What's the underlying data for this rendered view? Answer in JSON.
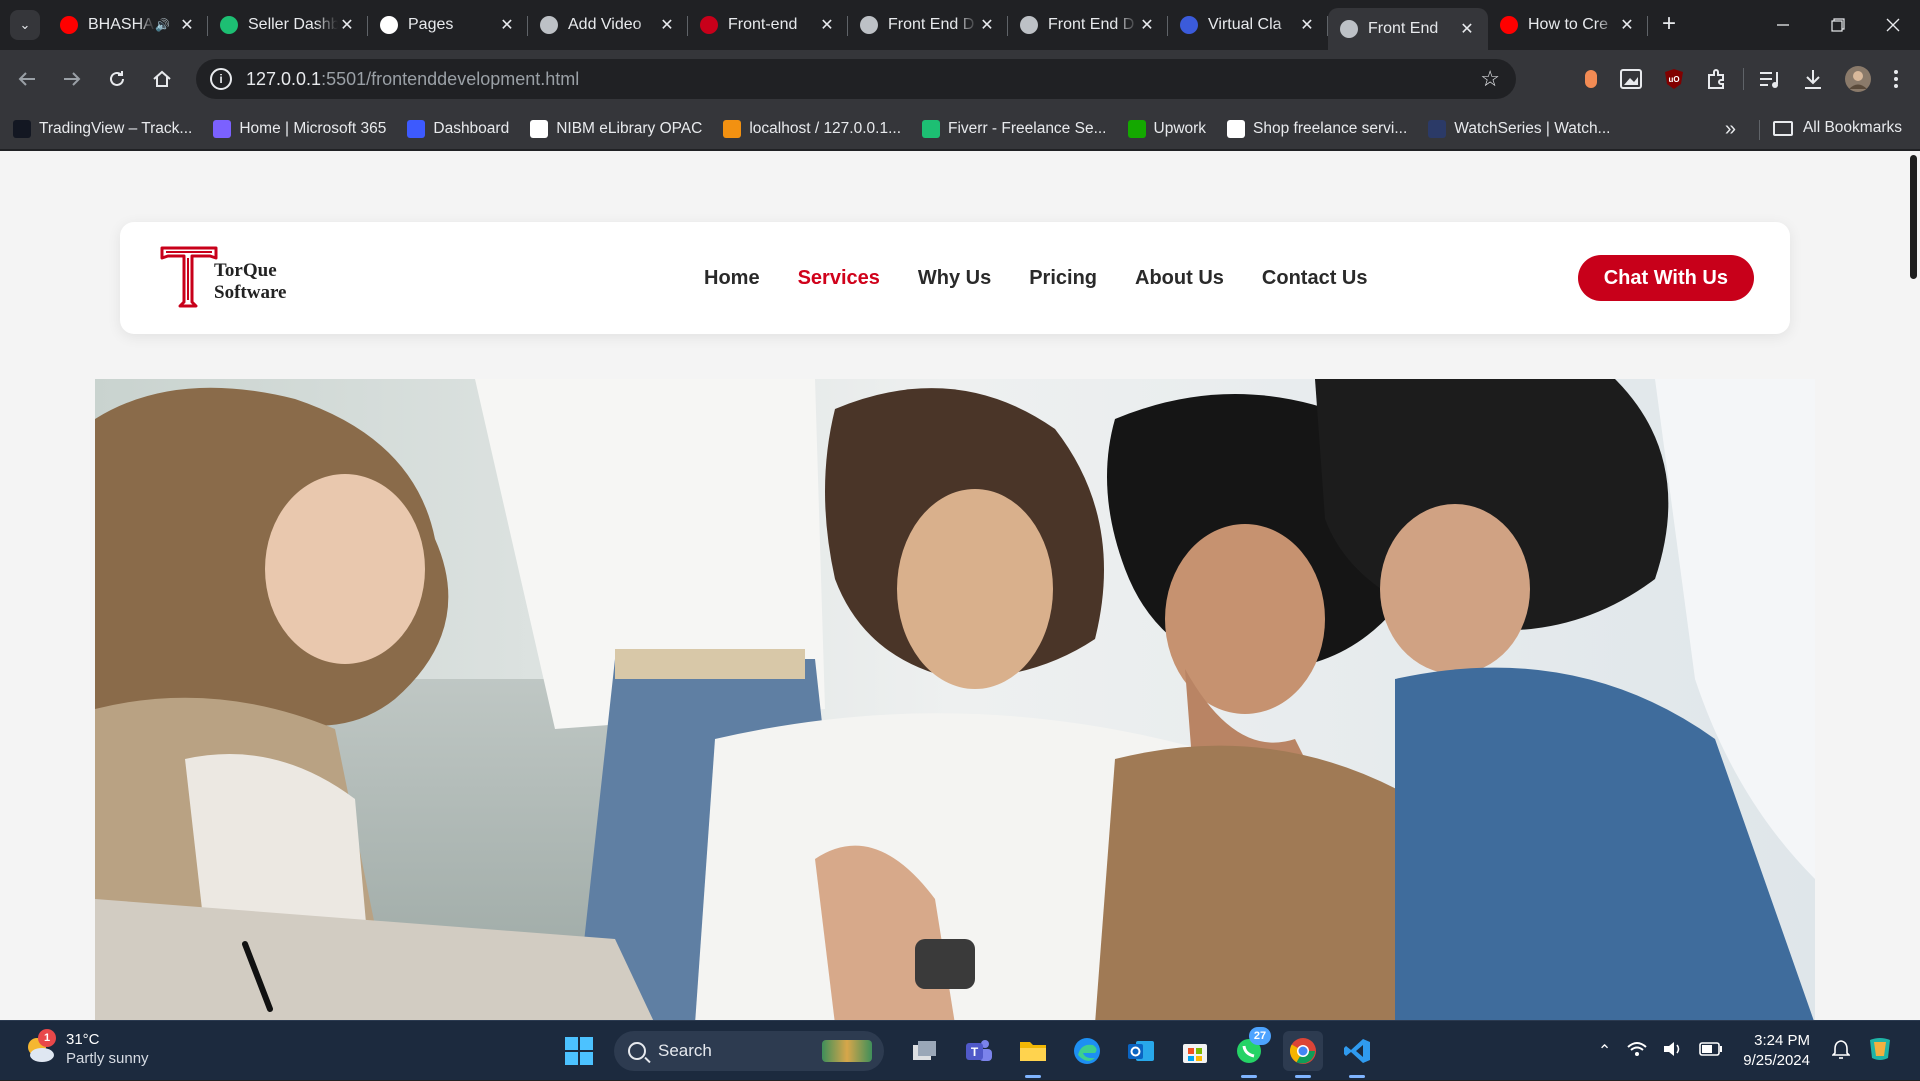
{
  "browser": {
    "tabs": [
      {
        "title": "BHASHA",
        "favicon": "youtube-icon",
        "color": "#ff0000",
        "audio": true,
        "active": false
      },
      {
        "title": "Seller Dashboard",
        "favicon": "fiverr-icon",
        "color": "#1dbf73",
        "active": false
      },
      {
        "title": "Pages",
        "favicon": "github-icon",
        "color": "#ffffff",
        "active": false
      },
      {
        "title": "Add Video",
        "favicon": "openai-icon",
        "color": "#bdc1c6",
        "active": false
      },
      {
        "title": "Front-end",
        "favicon": "torque-icon",
        "color": "#c8001a",
        "active": false
      },
      {
        "title": "Front End D",
        "favicon": "globe-icon",
        "color": "#bdc1c6",
        "active": false
      },
      {
        "title": "Front End D",
        "favicon": "globe-icon",
        "color": "#bdc1c6",
        "active": false
      },
      {
        "title": "Virtual Cla",
        "favicon": "n-icon",
        "color": "#3b5bdb",
        "active": false
      },
      {
        "title": "Front End",
        "favicon": "globe-icon",
        "color": "#bdc1c6",
        "active": true
      },
      {
        "title": "How to Cre",
        "favicon": "youtube-icon",
        "color": "#ff0000",
        "active": false
      }
    ],
    "url_host": "127.0.0.1",
    "url_rest": ":5501/frontenddevelopment.html",
    "bookmarks": [
      {
        "label": "TradingView – Track...",
        "icon": "tradingview-icon",
        "color": "#131722"
      },
      {
        "label": "Home | Microsoft 365",
        "icon": "microsoft365-icon",
        "color": "#7b61ff"
      },
      {
        "label": "Dashboard",
        "icon": "dashboard-icon",
        "color": "#3d5afe"
      },
      {
        "label": "NIBM eLibrary OPAC",
        "icon": "library-icon",
        "color": "#ffffff"
      },
      {
        "label": "localhost / 127.0.0.1...",
        "icon": "phpmyadmin-icon",
        "color": "#f29111"
      },
      {
        "label": "Fiverr - Freelance Se...",
        "icon": "fiverr-icon",
        "color": "#1dbf73"
      },
      {
        "label": "Upwork",
        "icon": "upwork-icon",
        "color": "#14a800"
      },
      {
        "label": "Shop freelance servi...",
        "icon": "k-icon",
        "color": "#ffffff"
      },
      {
        "label": "WatchSeries | Watch...",
        "icon": "watchseries-icon",
        "color": "#2b3a67"
      }
    ],
    "all_bookmarks_label": "All Bookmarks"
  },
  "site": {
    "logo_line1": "TorQue",
    "logo_line2": "Software",
    "brand_color": "#c8001a",
    "nav": [
      {
        "label": "Home",
        "active": false
      },
      {
        "label": "Services",
        "active": true
      },
      {
        "label": "Why Us",
        "active": false
      },
      {
        "label": "Pricing",
        "active": false
      },
      {
        "label": "About Us",
        "active": false
      },
      {
        "label": "Contact Us",
        "active": false
      }
    ],
    "cta_label": "Chat With Us",
    "hero_image": "four-developers-looking-at-screen-photo"
  },
  "taskbar": {
    "weather_temp": "31°C",
    "weather_desc": "Partly sunny",
    "weather_badge": "1",
    "search_label": "Search",
    "whatsapp_badge": "27",
    "time": "3:24 PM",
    "date": "9/25/2024"
  }
}
